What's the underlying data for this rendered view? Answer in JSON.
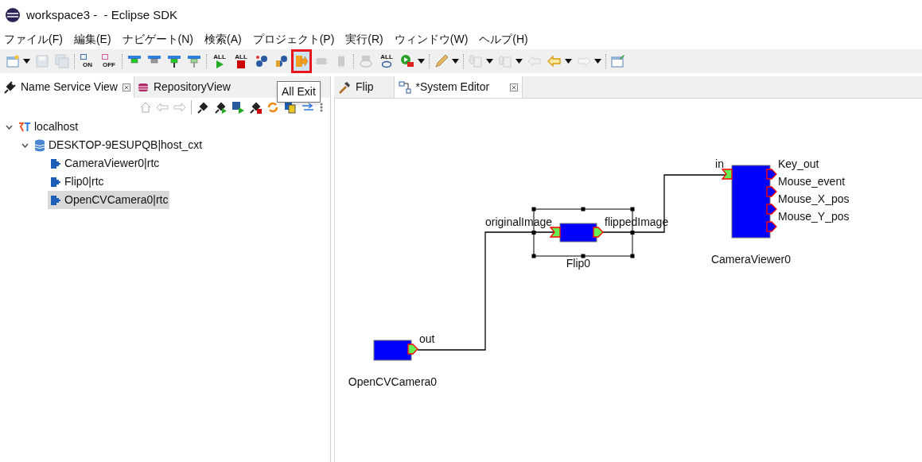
{
  "window": {
    "title": "workspace3 -  - Eclipse SDK"
  },
  "menu": [
    "ファイル(F)",
    "編集(E)",
    "ナビゲート(N)",
    "検索(A)",
    "プロジェクト(P)",
    "実行(R)",
    "ウィンドウ(W)",
    "ヘルプ(H)"
  ],
  "toolbar": [
    {
      "kind": "new",
      "dropdown": true,
      "disabled": false,
      "highlighted": false
    },
    {
      "kind": "save",
      "disabled": true,
      "highlighted": false
    },
    {
      "kind": "save-all",
      "disabled": true,
      "highlighted": false
    },
    {
      "kind": "separator"
    },
    {
      "kind": "switch-on",
      "label": "ON",
      "disabled": false,
      "highlighted": false
    },
    {
      "kind": "switch-off",
      "label": "OFF",
      "disabled": false,
      "highlighted": false
    },
    {
      "kind": "separator"
    },
    {
      "kind": "bar-green",
      "disabled": false,
      "highlighted": false
    },
    {
      "kind": "bar-gray",
      "disabled": false,
      "highlighted": false
    },
    {
      "kind": "bar-green-stem",
      "disabled": false,
      "highlighted": false
    },
    {
      "kind": "bar-gray-stem",
      "disabled": false,
      "highlighted": false
    },
    {
      "kind": "separator"
    },
    {
      "kind": "all-play",
      "label": "ALL",
      "disabled": false,
      "highlighted": false
    },
    {
      "kind": "all-stop",
      "label": "ALL",
      "disabled": false,
      "highlighted": false
    },
    {
      "kind": "gears",
      "disabled": false,
      "highlighted": false
    },
    {
      "kind": "gears-pause",
      "disabled": false,
      "highlighted": false
    },
    {
      "kind": "exit",
      "disabled": false,
      "highlighted": true
    },
    {
      "kind": "chip",
      "disabled": true,
      "highlighted": false
    },
    {
      "kind": "chip-vertical",
      "disabled": true,
      "highlighted": false
    },
    {
      "kind": "separator"
    },
    {
      "kind": "eye",
      "disabled": true,
      "highlighted": false
    },
    {
      "kind": "all-eye",
      "label": "ALL",
      "disabled": false,
      "highlighted": false
    },
    {
      "kind": "run-config",
      "dropdown": true,
      "disabled": false,
      "highlighted": false
    },
    {
      "kind": "separator"
    },
    {
      "kind": "pen",
      "dropdown": true,
      "disabled": false,
      "highlighted": false
    },
    {
      "kind": "separator"
    },
    {
      "kind": "down-doc",
      "dropdown": true,
      "disabled": true,
      "highlighted": false
    },
    {
      "kind": "up-doc",
      "dropdown": true,
      "disabled": true,
      "highlighted": false
    },
    {
      "kind": "back-edit",
      "disabled": true,
      "highlighted": false
    },
    {
      "kind": "back",
      "dropdown": true,
      "disabled": false,
      "highlighted": false
    },
    {
      "kind": "forward",
      "dropdown": true,
      "disabled": true,
      "highlighted": false
    },
    {
      "kind": "separator"
    },
    {
      "kind": "perspective",
      "disabled": false,
      "highlighted": false
    }
  ],
  "tooltip": "All Exit",
  "left_tabs": [
    {
      "label": "Name Service View",
      "selected": true
    },
    {
      "label": "RepositoryView",
      "selected": false
    }
  ],
  "tree": [
    {
      "label": "localhost",
      "kind": "root",
      "expanded": true,
      "selected": false,
      "children": [
        {
          "label": "DESKTOP-9ESUPQB|host_cxt",
          "kind": "host",
          "expanded": true,
          "selected": false,
          "children": [
            {
              "label": "CameraViewer0|rtc",
              "kind": "rtc",
              "selected": false
            },
            {
              "label": "Flip0|rtc",
              "kind": "rtc",
              "selected": false
            },
            {
              "label": "OpenCVCamera0|rtc",
              "kind": "rtc",
              "selected": true
            }
          ]
        }
      ]
    }
  ],
  "editor_tabs": [
    {
      "label": "Flip",
      "kind": "hammer",
      "selected": false
    },
    {
      "label": "*System Editor",
      "kind": "system",
      "selected": true
    }
  ],
  "diagram": {
    "components": [
      {
        "name": "Flip0",
        "selected": true,
        "in_ports": [
          {
            "name": "originalImage",
            "connected": true
          }
        ],
        "out_ports": [
          {
            "name": "flippedImage",
            "connected": true
          }
        ]
      },
      {
        "name": "CameraViewer0",
        "selected": false,
        "in_ports": [
          {
            "name": "in",
            "connected": true
          }
        ],
        "out_ports": [
          {
            "name": "Key_out",
            "connected": false
          },
          {
            "name": "Mouse_event",
            "connected": false
          },
          {
            "name": "Mouse_X_pos",
            "connected": false
          },
          {
            "name": "Mouse_Y_pos",
            "connected": false
          }
        ]
      },
      {
        "name": "OpenCVCamera0",
        "selected": false,
        "out_ports": [
          {
            "name": "out",
            "connected": true
          }
        ]
      }
    ]
  }
}
